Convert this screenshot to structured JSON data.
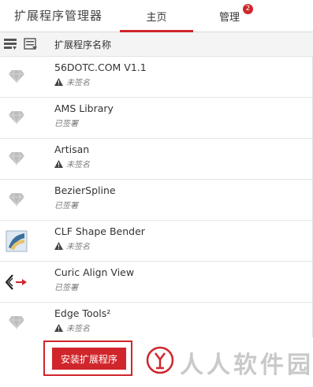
{
  "header": {
    "app_title": "扩展程序管理器",
    "tabs": [
      {
        "label": "主页",
        "active": true
      },
      {
        "label": "管理",
        "badge": "2"
      }
    ]
  },
  "column_header": {
    "name_label": "扩展程序名称"
  },
  "extensions": [
    {
      "name": "56DOTC.COM V1.1",
      "status": "未签名",
      "signed": false,
      "icon": "diamond-icon"
    },
    {
      "name": "AMS Library",
      "status": "已签署",
      "signed": true,
      "icon": "diamond-icon"
    },
    {
      "name": "Artisan",
      "status": "未签名",
      "signed": false,
      "icon": "diamond-icon"
    },
    {
      "name": "BezierSpline",
      "status": "已签署",
      "signed": true,
      "icon": "diamond-icon"
    },
    {
      "name": "CLF Shape Bender",
      "status": "未签名",
      "signed": false,
      "icon": "shape-bender-icon"
    },
    {
      "name": "Curic Align View",
      "status": "已签署",
      "signed": true,
      "icon": "align-view-icon"
    },
    {
      "name": "Edge Tools²",
      "status": "未签名",
      "signed": false,
      "icon": "diamond-icon"
    }
  ],
  "footer": {
    "install_button": "安装扩展程序",
    "watermark": "人人软件园"
  },
  "colors": {
    "accent": "#d0262b",
    "icon_gray": "#b5b5b5"
  }
}
